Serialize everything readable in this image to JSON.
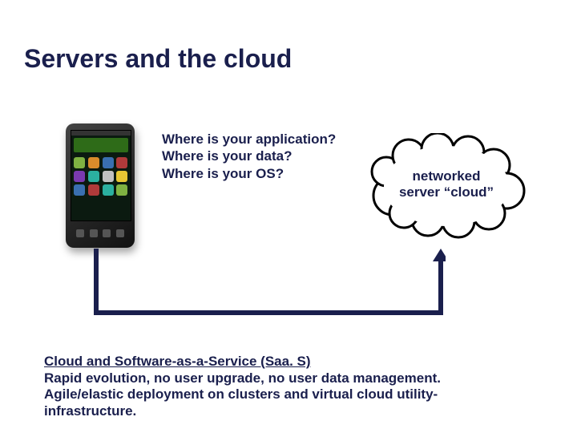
{
  "title": "Servers and the cloud",
  "questions": {
    "line1": "Where is your application?",
    "line2": "Where is your data?",
    "line3": "Where is your OS?"
  },
  "cloud": {
    "line1": "networked",
    "line2": "server “cloud”"
  },
  "bottom": {
    "heading": "Cloud and Software-as-a-Service (Saa. S)",
    "line1": "Rapid evolution, no user upgrade, no user data management.",
    "line2": "Agile/elastic deployment on clusters and virtual cloud utility-",
    "line3": "infrastructure."
  },
  "phone_icon_colors": [
    "#7fb242",
    "#d98c2b",
    "#3a6fb0",
    "#b03a3a",
    "#7a3ab0",
    "#2bb0a0",
    "#c0c0c0",
    "#e6c733",
    "#3a6fb0",
    "#b03a3a",
    "#2bb0a0",
    "#7fb242"
  ]
}
